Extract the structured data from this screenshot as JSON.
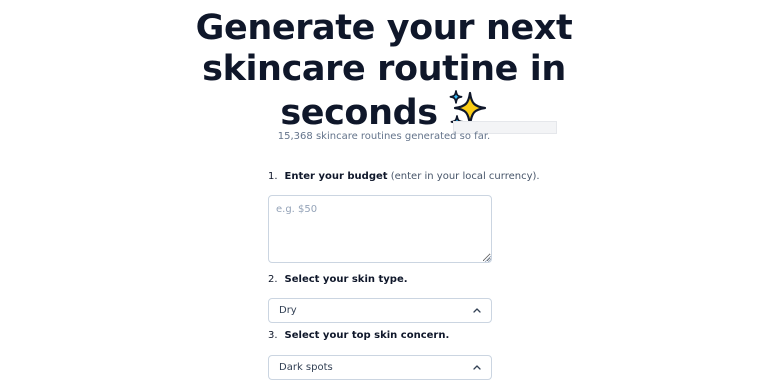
{
  "hero": {
    "title_line1": "Generate your next",
    "title_line2": "skincare routine in",
    "title_line3": "seconds",
    "icon": "sparkles-icon"
  },
  "subtitle": "15,368 skincare routines generated so far.",
  "tooltip_ghost": "",
  "form": {
    "step1": {
      "number": "1.",
      "label_strong": "Enter your budget",
      "label_muted": " (enter in your local currency).",
      "placeholder": "e.g. $50",
      "value": ""
    },
    "step2": {
      "number": "2.",
      "label_strong": "Select your skin type.",
      "selected": "Dry"
    },
    "step3": {
      "number": "3.",
      "label_strong": "Select your top skin concern.",
      "selected": "Dark spots"
    }
  },
  "colors": {
    "title": "#0f172a",
    "muted": "#64748b",
    "border": "#cbd5e1",
    "sparkle_yellow": "#facc15",
    "sparkle_blue": "#38bdf8"
  }
}
